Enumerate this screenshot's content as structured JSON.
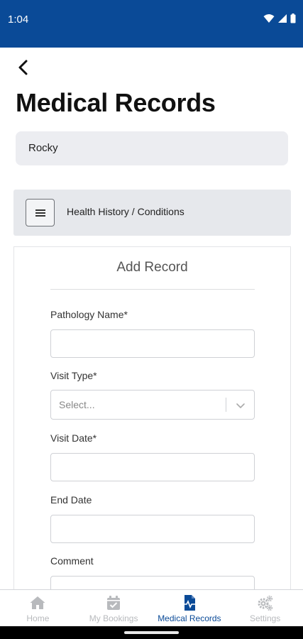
{
  "status_bar": {
    "time": "1:04",
    "icons": [
      "wifi-icon",
      "signal-icon",
      "battery-icon"
    ]
  },
  "header": {
    "back_icon": "back-arrow-icon",
    "title": "Medical Records"
  },
  "pet_selector": {
    "value": "Rocky"
  },
  "category": {
    "menu_icon": "hamburger-menu-icon",
    "label": "Health History / Conditions"
  },
  "form": {
    "heading": "Add Record",
    "fields": {
      "pathology_name": {
        "label": "Pathology Name*",
        "value": ""
      },
      "visit_type": {
        "label": "Visit Type*",
        "placeholder": "Select..."
      },
      "visit_date": {
        "label": "Visit Date*",
        "value": ""
      },
      "end_date": {
        "label": "End Date",
        "value": ""
      },
      "comment": {
        "label": "Comment",
        "value": ""
      }
    }
  },
  "bottom_nav": {
    "items": [
      {
        "label": "Home",
        "icon": "home-icon",
        "active": false
      },
      {
        "label": "My Bookings",
        "icon": "calendar-check-icon",
        "active": false
      },
      {
        "label": "Medical Records",
        "icon": "medical-file-icon",
        "active": true
      },
      {
        "label": "Settings",
        "icon": "gears-icon",
        "active": false
      }
    ]
  },
  "colors": {
    "primary": "#0a4a97",
    "inactive_nav": "#b8babd",
    "field_background": "#ecedf1"
  }
}
